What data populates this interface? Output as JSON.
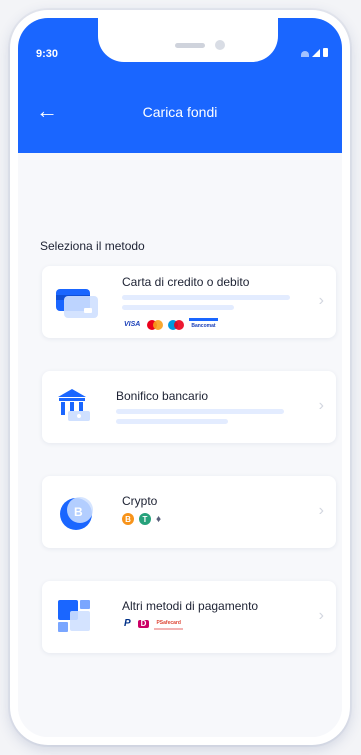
{
  "status": {
    "time": "9:30"
  },
  "header": {
    "back_icon": "arrow-left-icon",
    "title": "Carica fondi"
  },
  "section": {
    "label": "Seleziona il metodo"
  },
  "methods": [
    {
      "label": "Carta di credito o debito",
      "icon": "credit-card-icon",
      "logos": [
        "VISA",
        "mastercard-icon",
        "maestro-icon",
        "Bancomat"
      ]
    },
    {
      "label": "Bonifico bancario",
      "icon": "bank-icon",
      "logos": []
    },
    {
      "label": "Crypto",
      "icon": "bitcoin-icon",
      "logos": [
        "B",
        "T",
        "♦"
      ]
    },
    {
      "label": "Altri metodi di pagamento",
      "icon": "payment-methods-icon",
      "logos": [
        "P",
        "D",
        "PSafecard"
      ]
    }
  ],
  "colors": {
    "primary": "#1a66ff",
    "background": "#f7f8fb"
  }
}
